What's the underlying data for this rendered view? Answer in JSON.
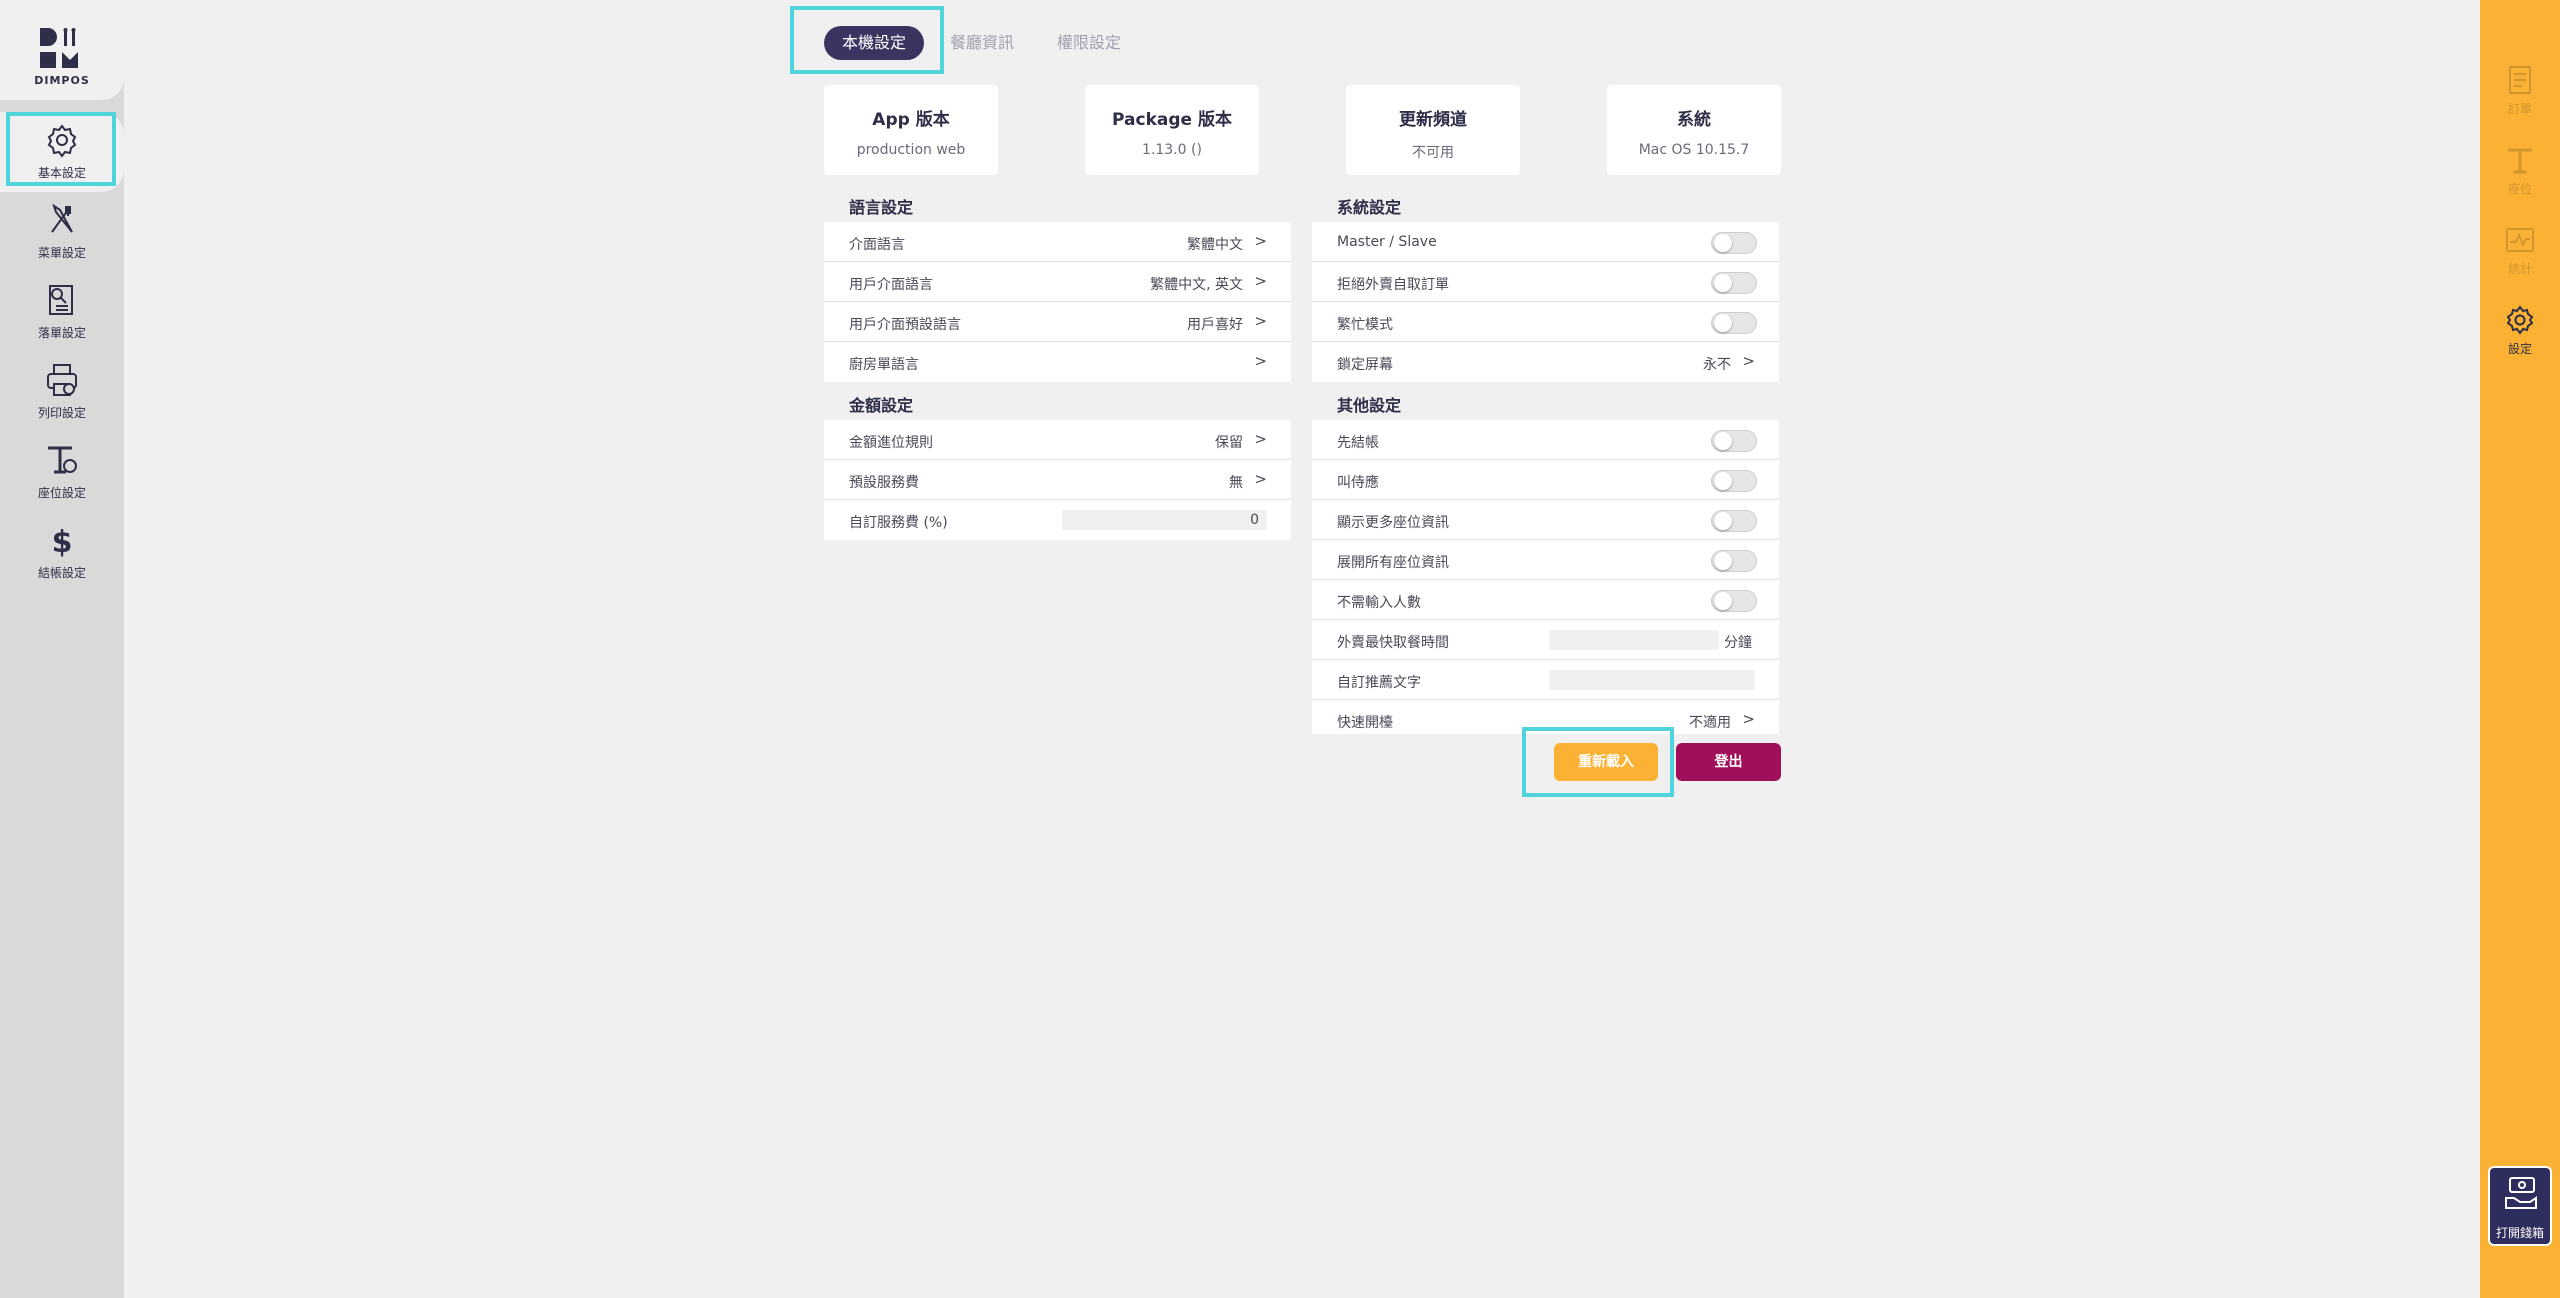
{
  "brand": {
    "name": "DIMPOS"
  },
  "sidebar": {
    "items": [
      {
        "label": "基本設定",
        "icon": "gear-icon",
        "active": true
      },
      {
        "label": "菜單設定",
        "icon": "fork-knife-icon"
      },
      {
        "label": "落單設定",
        "icon": "order-search-icon"
      },
      {
        "label": "列印設定",
        "icon": "printer-icon"
      },
      {
        "label": "座位設定",
        "icon": "table-icon"
      },
      {
        "label": "結帳設定",
        "icon": "dollar-icon"
      }
    ]
  },
  "right_nav": {
    "items": [
      {
        "label": "訂單",
        "icon": "receipt-icon"
      },
      {
        "label": "座位",
        "icon": "table-icon"
      },
      {
        "label": "統計",
        "icon": "chart-icon"
      },
      {
        "label": "設定",
        "icon": "gear-icon",
        "active": true
      }
    ],
    "cash_drawer": {
      "label": "打開錢箱",
      "icon": "cash-drawer-icon"
    }
  },
  "tabs": [
    {
      "label": "本機設定",
      "active": true
    },
    {
      "label": "餐廳資訊"
    },
    {
      "label": "權限設定"
    }
  ],
  "info_cards": [
    {
      "title": "App 版本",
      "value": "production web"
    },
    {
      "title": "Package 版本",
      "value": "1.13.0 ()"
    },
    {
      "title": "更新頻道",
      "value": "不可用"
    },
    {
      "title": "系統",
      "value": "Mac OS 10.15.7"
    }
  ],
  "language": {
    "title": "語言設定",
    "rows": [
      {
        "label": "介面語言",
        "value": "繁體中文"
      },
      {
        "label": "用戶介面語言",
        "value": "繁體中文, 英文"
      },
      {
        "label": "用戶介面預設語言",
        "value": "用戶喜好"
      },
      {
        "label": "廚房單語言",
        "value": ""
      }
    ]
  },
  "amount": {
    "title": "金額設定",
    "rows": [
      {
        "label": "金額進位規則",
        "value": "保留"
      },
      {
        "label": "預設服務費",
        "value": "無"
      },
      {
        "label": "自訂服務費 (%)",
        "input_value": "0"
      }
    ]
  },
  "system": {
    "title": "系統設定",
    "rows": [
      {
        "label": "Master / Slave",
        "toggle": false
      },
      {
        "label": "拒絕外賣自取訂單",
        "toggle": false
      },
      {
        "label": "繁忙模式",
        "toggle": false
      },
      {
        "label": "鎖定屏幕",
        "value": "永不"
      }
    ]
  },
  "other": {
    "title": "其他設定",
    "rows": [
      {
        "label": "先結帳",
        "toggle": false
      },
      {
        "label": "叫侍應",
        "toggle": false
      },
      {
        "label": "顯示更多座位資訊",
        "toggle": false
      },
      {
        "label": "展開所有座位資訊",
        "toggle": false
      },
      {
        "label": "不需輸入人數",
        "toggle": false
      },
      {
        "label": "外賣最快取餐時間",
        "input_value": "",
        "unit": "分鐘"
      },
      {
        "label": "自訂推薦文字",
        "input_value": ""
      },
      {
        "label": "快速開檯",
        "value": "不適用"
      }
    ]
  },
  "actions": {
    "reload": "重新載入",
    "logout": "登出"
  },
  "colors": {
    "accent": "#fbb234",
    "primary": "#3a3560",
    "danger": "#a0105a",
    "highlight": "#4fd4dc"
  }
}
